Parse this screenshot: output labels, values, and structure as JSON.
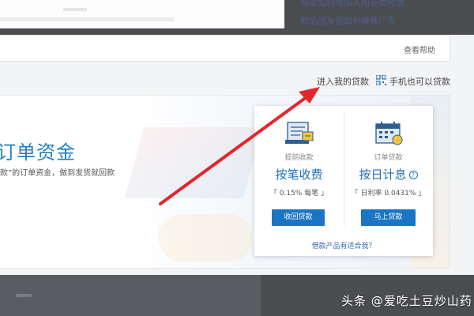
{
  "top": {
    "link1": "淘宝如何增加入用品类经营",
    "link2": "微信朋友圈如何屏蔽广告"
  },
  "help": {
    "label": "查看帮助"
  },
  "links": {
    "enter_loan": "进入我的贷款",
    "mobile_loan": "手机也可以贷款"
  },
  "banner": {
    "title": "订单资金",
    "subtitle": "款”的订单资金，做到发货就回款"
  },
  "card": {
    "left": {
      "caption": "提前收款",
      "headline": "按笔收费",
      "rate": "「 0.15% 每笔 」",
      "button": "收回贷款"
    },
    "right": {
      "caption": "订单贷款",
      "headline": "按日计息",
      "info_icon": "?",
      "rate": "「 日利率 0.0431% 」",
      "button": "马上贷款"
    },
    "footer": "借款产品有适合我？"
  },
  "watermark": "头条 @爱吃土豆炒山药",
  "colors": {
    "accent": "#1a76c4",
    "arrow": "#e3262b",
    "title_blue": "#1f7ec6"
  },
  "icons": {
    "qr": "qr-code-icon",
    "receipt": "receipt-icon",
    "calendar": "calendar-icon",
    "arrow": "red-arrow"
  }
}
